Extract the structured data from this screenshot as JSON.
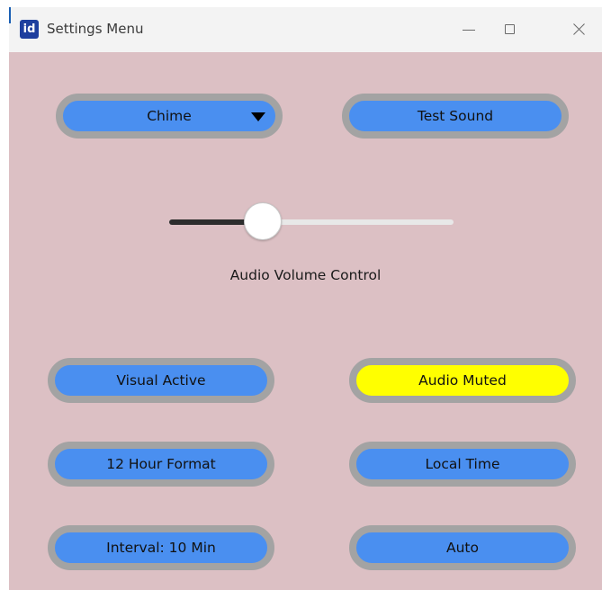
{
  "window": {
    "title": "Settings Menu",
    "icon_text": "id",
    "background_color": "#dcc0c4",
    "controls": {
      "minimize": "minimize-icon",
      "maximize": "maximize-icon",
      "close": "close-icon"
    }
  },
  "sound": {
    "selected_sound": "Chime",
    "test_label": "Test Sound"
  },
  "volume": {
    "label": "Audio Volume Control",
    "level": 0.33
  },
  "toggles": {
    "visual": "Visual Active",
    "audio": "Audio Muted",
    "audio_color": "#ffff00",
    "time_format": "12 Hour Format",
    "time_zone": "Local Time",
    "interval": "Interval: 10 Min",
    "mode": "Auto"
  },
  "colors": {
    "button_fill": "#4a8ff0",
    "button_border": "#a3a3a3"
  }
}
